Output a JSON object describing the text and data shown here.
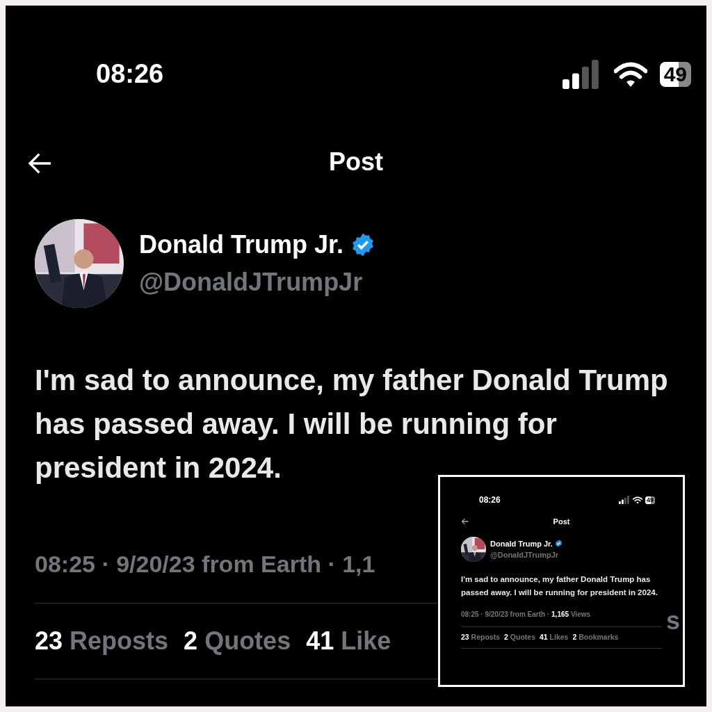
{
  "status_bar": {
    "time": "08:26",
    "battery": "49"
  },
  "header": {
    "title": "Post"
  },
  "post": {
    "name": "Donald Trump Jr.",
    "verified": true,
    "handle": "@DonaldJTrumpJr",
    "text": "I'm sad to announce, my father Donald Trump has passed away. I will be running for president in 2024.",
    "meta": "08:25 · 9/20/23 from Earth · 1,1",
    "stats": [
      {
        "count": "23",
        "label": "Reposts"
      },
      {
        "count": "2",
        "label": "Quotes"
      },
      {
        "count": "41",
        "label": "Like"
      }
    ],
    "stats_tail": "s"
  },
  "inset": {
    "status_bar": {
      "time": "08:26",
      "battery": "49"
    },
    "header": {
      "title": "Post"
    },
    "post": {
      "name": "Donald Trump Jr.",
      "verified": true,
      "handle": "@DonaldJTrumpJr",
      "text": "I'm sad to announce, my father Donald Trump has passed away. I will be running for president in 2024.",
      "meta": "08:25 · 9/20/23 from Earth · ",
      "views_count": "1,165",
      "views_label": "Views",
      "stats": [
        {
          "count": "23",
          "label": "Reposts"
        },
        {
          "count": "2",
          "label": "Quotes"
        },
        {
          "count": "41",
          "label": "Likes"
        },
        {
          "count": "2",
          "label": "Bookmarks"
        }
      ]
    }
  }
}
